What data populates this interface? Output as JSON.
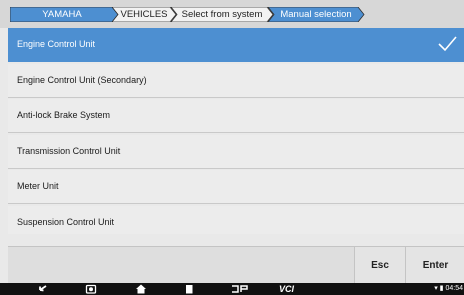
{
  "breadcrumb": {
    "items": [
      {
        "label": "YAMAHA"
      },
      {
        "label": "VEHICLES"
      },
      {
        "label": "Select from system"
      },
      {
        "label": "Manual selection"
      }
    ]
  },
  "list": {
    "items": [
      {
        "label": "Engine Control Unit",
        "selected": true
      },
      {
        "label": "Engine Control Unit (Secondary)",
        "selected": false
      },
      {
        "label": "Anti-lock Brake System",
        "selected": false
      },
      {
        "label": "Transmission Control Unit",
        "selected": false
      },
      {
        "label": "Meter Unit",
        "selected": false
      },
      {
        "label": "Suspension Control Unit",
        "selected": false
      }
    ]
  },
  "buttons": {
    "esc_label": "Esc",
    "enter_label": "Enter"
  },
  "navbar": {
    "vci_label": "VCI",
    "time": "04:54",
    "status_prefix": "▾ ▮"
  },
  "colors": {
    "selected": "#4d8fd1",
    "crumb_active": "#4d8fd1",
    "crumb_inactive": "#f2f2f2"
  },
  "icons": [
    "back-icon",
    "camera-icon",
    "home-icon",
    "recents-icon",
    "dp-icon",
    "check-icon",
    "wifi-icon",
    "battery-icon"
  ]
}
